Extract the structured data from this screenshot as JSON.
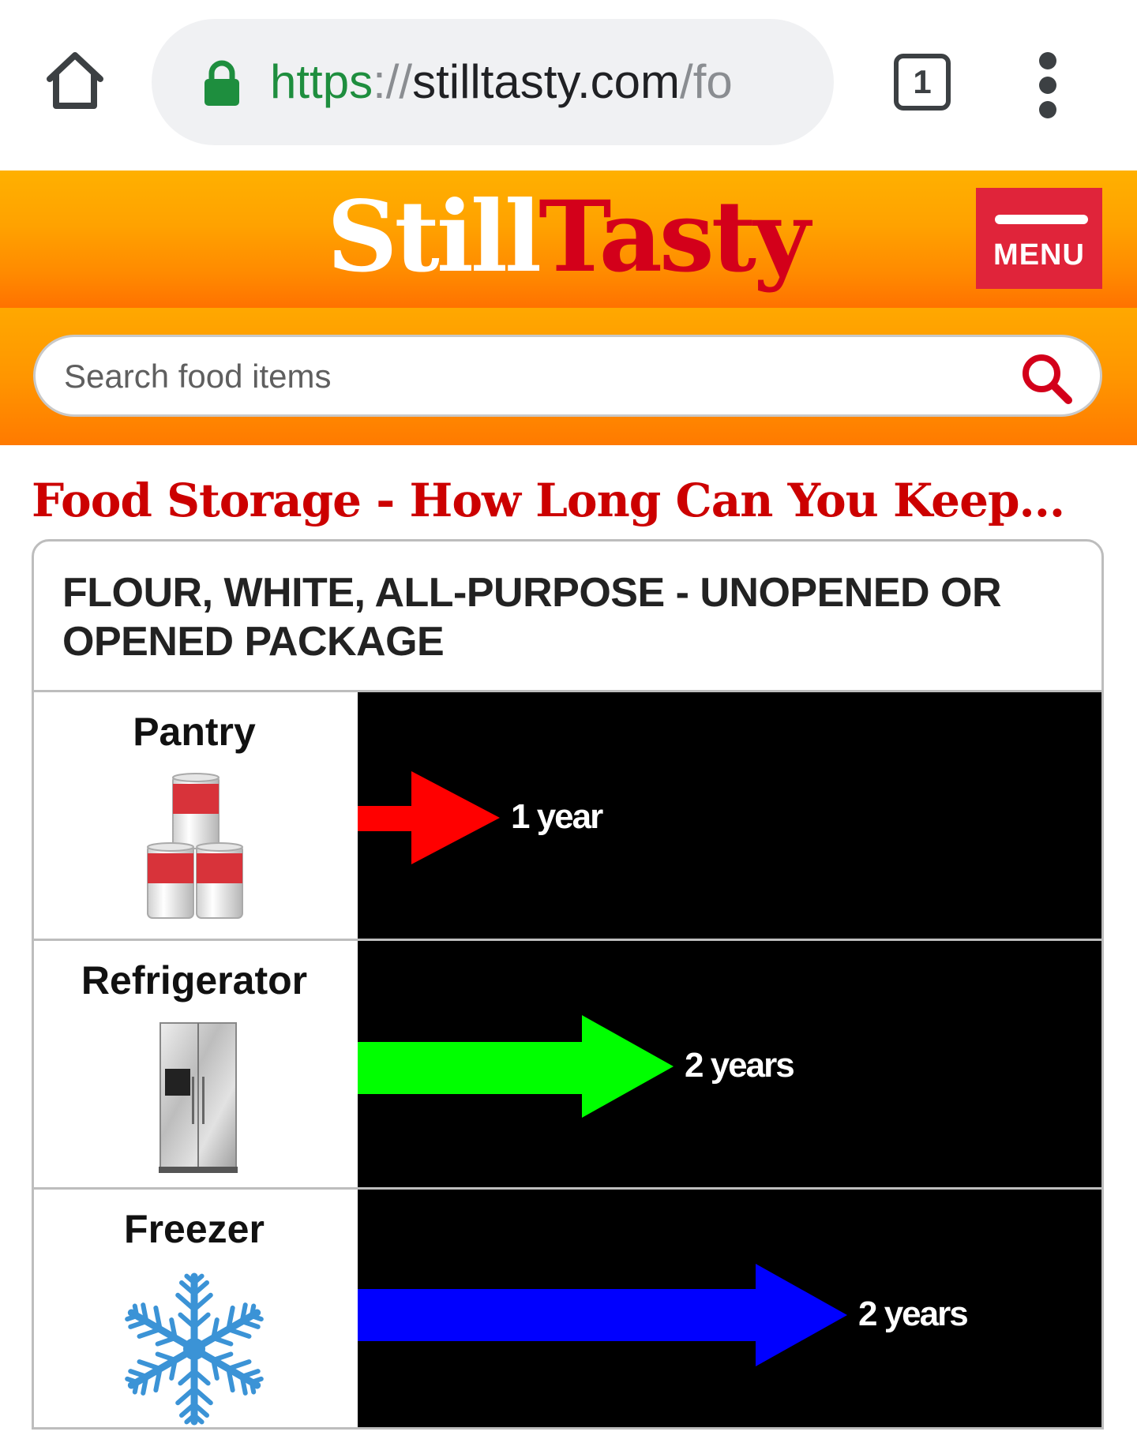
{
  "browser": {
    "url_scheme": "https",
    "url_separator": "://",
    "url_host": "stilltasty.com",
    "url_tail": "/fo",
    "tab_count": "1"
  },
  "site": {
    "logo_part1": "Still",
    "logo_part2": "Tasty",
    "menu_label": "MENU",
    "search_placeholder": "Search food items"
  },
  "page": {
    "title": "Food Storage - How Long Can You Keep...",
    "item_title": "FLOUR, WHITE, ALL-PURPOSE - UNOPENED OR OPENED PACKAGE"
  },
  "storage": [
    {
      "location": "Pantry",
      "icon": "canned-goods-icon",
      "duration": "1 year",
      "years": 1,
      "color": "#ff0000"
    },
    {
      "location": "Refrigerator",
      "icon": "refrigerator-icon",
      "duration": "2 years",
      "years": 2,
      "color": "#00ff00"
    },
    {
      "location": "Freezer",
      "icon": "snowflake-icon",
      "duration": "2 years",
      "years": 2,
      "color": "#0000ff"
    }
  ],
  "colors": {
    "logo_red": "#d3001a",
    "title_red": "#cc0000",
    "menu_red": "#e0243a",
    "header_orange": "#ff9600",
    "secure_green": "#1e8e3e"
  }
}
